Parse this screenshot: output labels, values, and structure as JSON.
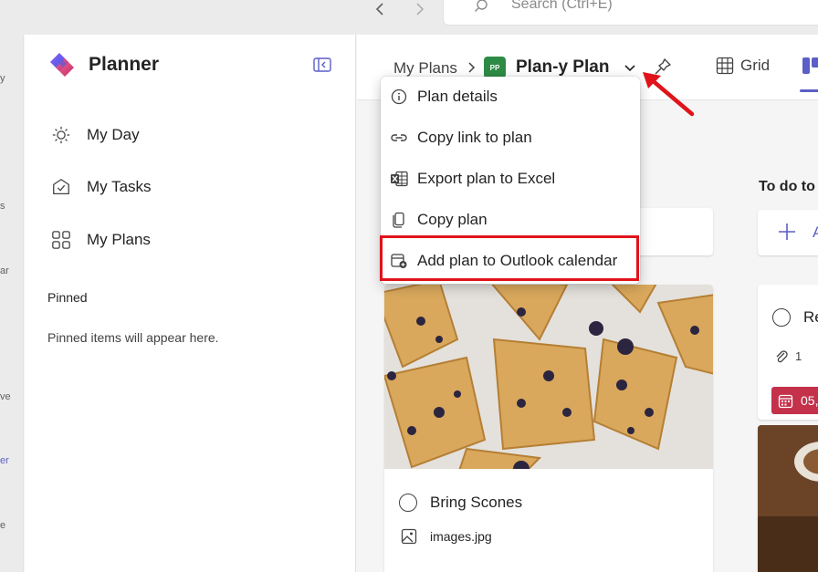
{
  "search": {
    "placeholder": "Search (Ctrl+E)"
  },
  "rail": {
    "fragments": [
      "y",
      "s",
      "ar",
      "ve",
      "er",
      "e"
    ]
  },
  "sidebar": {
    "app_name": "Planner",
    "items": [
      {
        "label": "My Day",
        "icon": "sun-icon"
      },
      {
        "label": "My Tasks",
        "icon": "task-icon"
      },
      {
        "label": "My Plans",
        "icon": "plans-grid-icon"
      }
    ],
    "pinned_title": "Pinned",
    "pinned_empty": "Pinned items will appear here."
  },
  "header": {
    "breadcrumb_root": "My Plans",
    "plan_initials": "PP",
    "plan_name": "Plan-y Plan",
    "view_grid": "Grid"
  },
  "menu": {
    "items": [
      {
        "label": "Plan details",
        "icon": "info-icon"
      },
      {
        "label": "Copy link to plan",
        "icon": "link-icon"
      },
      {
        "label": "Export plan to Excel",
        "icon": "excel-icon"
      },
      {
        "label": "Copy plan",
        "icon": "copy-icon"
      },
      {
        "label": "Add plan to Outlook calendar",
        "icon": "calendar-add-icon"
      }
    ]
  },
  "board": {
    "column_todo": "To do to",
    "add_task_label": "A",
    "task_main": {
      "title": "Bring Scones",
      "attachment": "images.jpg"
    },
    "task_right": {
      "title": "Re",
      "attachments": "1",
      "due": "05,"
    }
  },
  "colors": {
    "accent": "#5b5fc7",
    "due_red": "#c4314b",
    "highlight": "#e0131a",
    "plan_green": "#2e8b45"
  }
}
